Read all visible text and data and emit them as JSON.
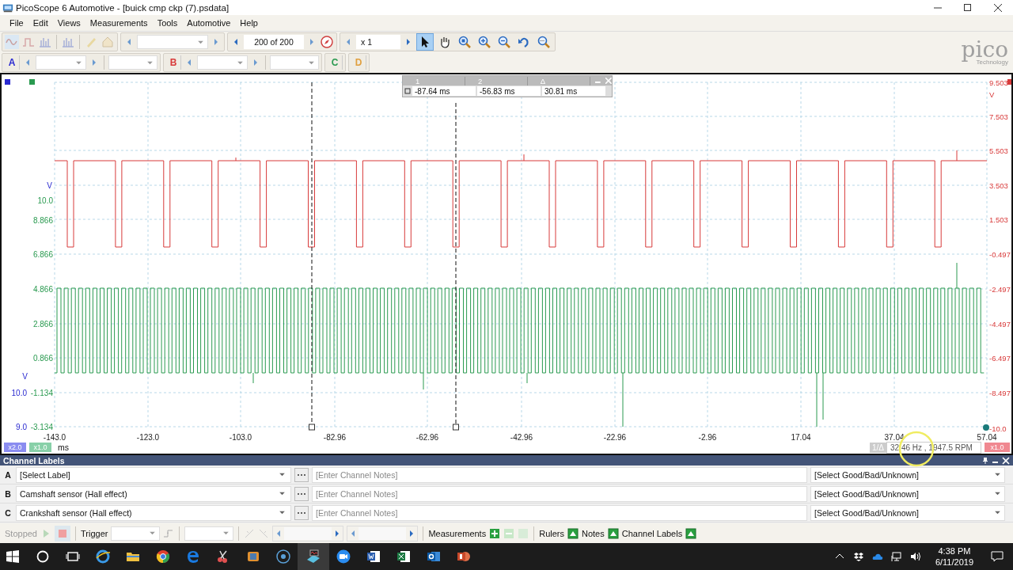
{
  "window": {
    "title": "PicoScope 6 Automotive - [buick cmp ckp (7).psdata]"
  },
  "menu": [
    "File",
    "Edit",
    "Views",
    "Measurements",
    "Tools",
    "Automotive",
    "Help"
  ],
  "toolbar": {
    "buffer": "200 of 200",
    "zoom": "x 1",
    "tools": [
      {
        "kind": "pointer",
        "selected": true
      },
      {
        "kind": "hand",
        "selected": false
      },
      {
        "kind": "zoom-region",
        "selected": false
      },
      {
        "kind": "zoom-in",
        "selected": false
      },
      {
        "kind": "zoom-out",
        "selected": false
      },
      {
        "kind": "undo",
        "selected": false
      },
      {
        "kind": "zoom-fit",
        "selected": false
      }
    ]
  },
  "channels": [
    {
      "letter": "A",
      "color": "#2a2ad0",
      "kind": "full"
    },
    {
      "letter": "B",
      "color": "#d83a3a",
      "kind": "full"
    },
    {
      "letter": "C",
      "color": "#2a9a50",
      "kind": "compact"
    },
    {
      "letter": "D",
      "color": "#e0a040",
      "kind": "compact"
    }
  ],
  "logo": {
    "name": "pico",
    "tagline": "Technology"
  },
  "scope": {
    "left_axis": [
      {
        "a": "V"
      },
      {
        "c": "10.0"
      },
      {
        "c": "8.866"
      },
      {
        "c": "6.866"
      },
      {
        "c": "4.866"
      },
      {
        "c": "2.866"
      },
      {
        "c": "0.866"
      },
      {
        "a": "V"
      },
      {
        "a": "10.0",
        "c": "-1.134"
      },
      {
        "a": "9.0",
        "c": "-3.134"
      }
    ],
    "right_axis": [
      "9.503",
      "V",
      "7.503",
      "5.503",
      "3.503",
      "1.503",
      "-0.497",
      "-2.497",
      "-4.497",
      "-6.497",
      "-8.497",
      "-10.0"
    ],
    "x_axis": [
      "-143.0",
      "-123.0",
      "-103.0",
      "-82.96",
      "-62.96",
      "-42.96",
      "-22.96",
      "-2.96",
      "17.04",
      "37.04",
      "57.04"
    ],
    "unit": "ms",
    "scales": [
      {
        "label": "x2.0",
        "color": "#8a8cf0"
      },
      {
        "label": "x1.0",
        "color": "#88d0a8"
      }
    ],
    "right_scale": {
      "label": "x1.0",
      "color": "#f08890"
    },
    "rulers": {
      "headers": [
        "1",
        "2",
        "Δ"
      ],
      "values": [
        "-87.64 ms",
        "-56.83 ms",
        "30.81 ms"
      ]
    },
    "frequency": {
      "label": "1/Δ",
      "value": "32.46 Hz , 1947.5 RPM"
    }
  },
  "channel_labels": {
    "title": "Channel Labels",
    "rows": [
      {
        "channel": "A",
        "label": "[Select Label]",
        "notes_placeholder": "[Enter Channel Notes]",
        "status": "[Select Good/Bad/Unknown]"
      },
      {
        "channel": "B",
        "label": "Camshaft sensor (Hall effect)",
        "notes_placeholder": "[Enter Channel Notes]",
        "status": "[Select Good/Bad/Unknown]"
      },
      {
        "channel": "C",
        "label": "Crankshaft sensor (Hall effect)",
        "notes_placeholder": "[Enter Channel Notes]",
        "status": "[Select Good/Bad/Unknown]"
      }
    ]
  },
  "status_bar": {
    "state": "Stopped",
    "trigger": "Trigger",
    "measurements": "Measurements",
    "toggles": [
      {
        "label": "Rulers",
        "on": true
      },
      {
        "label": "Notes",
        "on": true
      },
      {
        "label": "Channel Labels",
        "on": true
      }
    ]
  },
  "taskbar": {
    "time": "4:38 PM",
    "date": "6/11/2019"
  }
}
